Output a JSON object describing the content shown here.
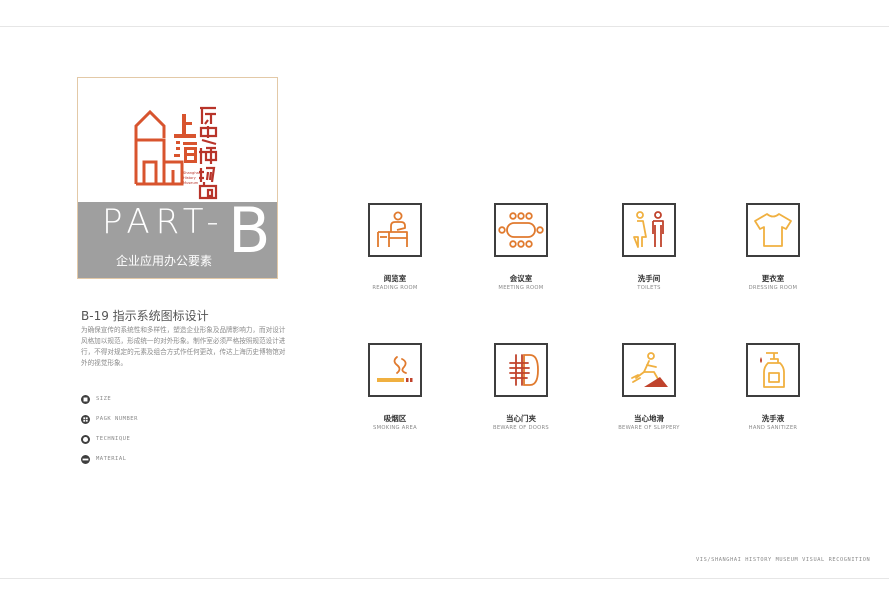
{
  "cover": {
    "logo": {
      "name_cn": "上海历史博物馆",
      "name_en_lines": [
        "Shanghai",
        "History",
        "Museum"
      ]
    },
    "part": "PART-",
    "part_letter": "B",
    "subtitle": "企业应用办公要素"
  },
  "section": {
    "title": "B-19 指示系统图标设计",
    "description": "为确保宣传的系统性和多样性，塑造企业形象及品牌影响力，而对设计风格加以规范，形成统一的对外形象。制作室必须严格按照规范设计进行，不得对规定的元素及组合方式作任何更改，传达上海历史博物馆对外的视觉形象。"
  },
  "legend": [
    {
      "icon": "size-icon",
      "label": "SIZE"
    },
    {
      "icon": "page-number-icon",
      "label": "PAGK NUMBER"
    },
    {
      "icon": "technique-icon",
      "label": "TECHNIQUE"
    },
    {
      "icon": "material-icon",
      "label": "MATERIAL"
    }
  ],
  "icons": [
    {
      "icon": "reading-room-icon",
      "cn": "阅览室",
      "en": "READING ROOM"
    },
    {
      "icon": "meeting-room-icon",
      "cn": "会议室",
      "en": "MEETING ROOM"
    },
    {
      "icon": "toilets-icon",
      "cn": "洗手间",
      "en": "TOILETS"
    },
    {
      "icon": "dressing-room-icon",
      "cn": "更衣室",
      "en": "DRESSING ROOM"
    },
    {
      "icon": "smoking-area-icon",
      "cn": "吸烟区",
      "en": "SMOKING AREA"
    },
    {
      "icon": "beware-of-doors-icon",
      "cn": "当心门夹",
      "en": "BEWARE OF DOORS"
    },
    {
      "icon": "beware-of-slippery-icon",
      "cn": "当心地滑",
      "en": "BEWARE OF SLIPPERY"
    },
    {
      "icon": "hand-sanitizer-icon",
      "cn": "洗手液",
      "en": "HAND SANITIZER"
    }
  ],
  "colors": {
    "orange": "#e07a2e",
    "yellow": "#f0b040",
    "red": "#c0432c",
    "frame": "#3e3e3e",
    "band": "#9f9f9f"
  },
  "footer": "VIS/SHANGHAI HISTORY MUSEUM VISUAL RECOGNITION"
}
